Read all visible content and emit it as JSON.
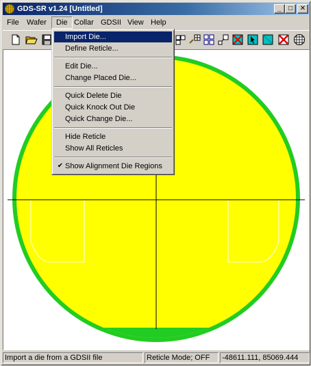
{
  "window": {
    "title": "GDS-SR v1.24 [Untitled]",
    "min_glyph": "_",
    "max_glyph": "□",
    "close_glyph": "✕"
  },
  "menubar": {
    "items": [
      {
        "label": "File"
      },
      {
        "label": "Wafer"
      },
      {
        "label": "Die"
      },
      {
        "label": "Collar"
      },
      {
        "label": "GDSII"
      },
      {
        "label": "View"
      },
      {
        "label": "Help"
      }
    ]
  },
  "toolbar": {
    "icons": [
      "new-icon",
      "open-icon",
      "save-icon",
      "die-grid-icon",
      "dotted-grid-icon",
      "quad-die-icon",
      "resize-die-icon",
      "knockout-die-icon",
      "cyan-cursor-die-icon",
      "cyan-die-icon",
      "red-knockout-die-icon",
      "full-grid-icon"
    ]
  },
  "die_menu": {
    "items": [
      {
        "label": "Import Die...",
        "highlighted": true
      },
      {
        "label": "Define Reticle..."
      },
      {
        "label": "Edit Die..."
      },
      {
        "label": "Change Placed Die..."
      },
      {
        "label": "Quick Delete Die"
      },
      {
        "label": "Quick Knock Out Die"
      },
      {
        "label": "Quick Change Die..."
      },
      {
        "label": "Hide Reticle"
      },
      {
        "label": "Show All Reticles"
      },
      {
        "label": "Show Alignment Die Regions",
        "checked": true
      }
    ],
    "check_glyph": "✔"
  },
  "wafer_view": {
    "wafer_edge_color": "#22cc22",
    "wafer_fill_color": "#ffff00",
    "crosshair_color": "#000000",
    "alignment_region_color": "#ffffff"
  },
  "statusbar": {
    "message": "Import a die from a GDSII file",
    "mode": "Reticle Mode; OFF",
    "coords": "-48611.111, 85069.444"
  },
  "colors": {
    "title_start": "#0a246a",
    "title_end": "#a6caf0",
    "highlight": "#0a246a"
  }
}
